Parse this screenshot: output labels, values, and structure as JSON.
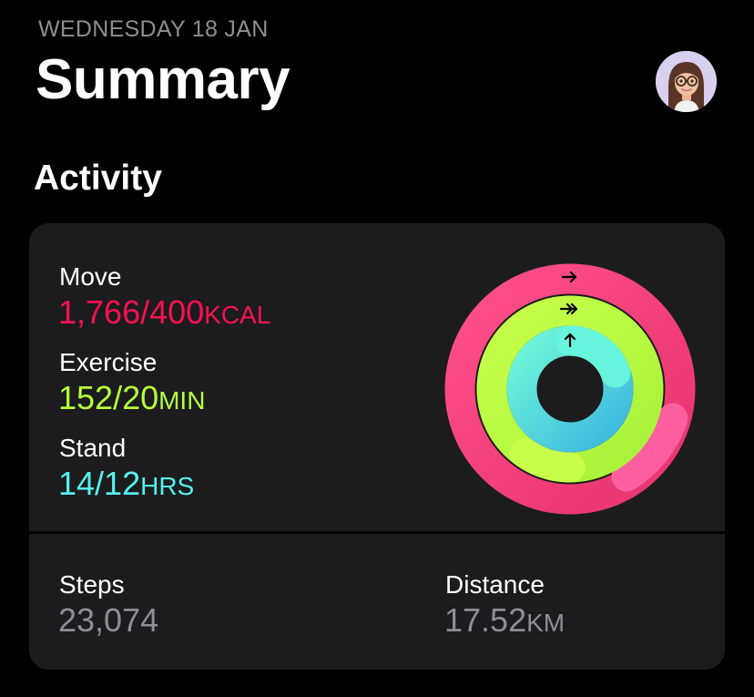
{
  "header": {
    "date": "WEDNESDAY 18 JAN",
    "title": "Summary"
  },
  "activity": {
    "section_title": "Activity",
    "move": {
      "label": "Move",
      "value": "1,766/400",
      "unit": "KCAL",
      "color": "#fa114f"
    },
    "exercise": {
      "label": "Exercise",
      "value": "152/20",
      "unit": "MIN",
      "color": "#b6ff3d"
    },
    "stand": {
      "label": "Stand",
      "value": "14/12",
      "unit": "HRS",
      "color": "#54f2ee"
    }
  },
  "stats": {
    "steps": {
      "label": "Steps",
      "value": "23,074"
    },
    "distance": {
      "label": "Distance",
      "value": "17.52",
      "unit": "KM"
    }
  },
  "colors": {
    "background": "#000000",
    "card": "#1c1c1e",
    "secondary_text": "#8e8e93"
  }
}
